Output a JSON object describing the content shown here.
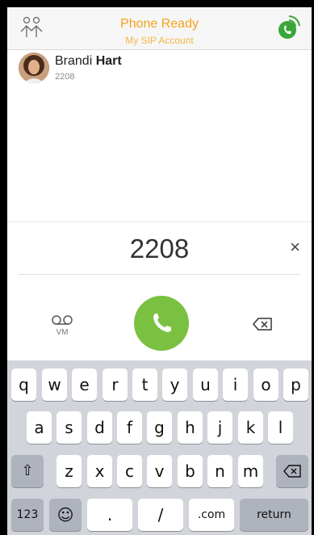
{
  "header": {
    "status_title": "Phone Ready",
    "status_subtitle": "My SIP Account",
    "left_icon": "contacts-icon",
    "right_icon": "call-status-icon",
    "accent_color": "#f5a31a",
    "status_icon_color": "#3aa63a"
  },
  "contact": {
    "first_name": "Brandi",
    "last_name": "Hart",
    "number": "2208"
  },
  "dialer": {
    "entered_number": "2208",
    "clear_label": "×",
    "voicemail_label": "VM",
    "call_color": "#7ac142"
  },
  "keyboard": {
    "row1": [
      "q",
      "w",
      "e",
      "r",
      "t",
      "y",
      "u",
      "i",
      "o",
      "p"
    ],
    "row2": [
      "a",
      "s",
      "d",
      "f",
      "g",
      "h",
      "j",
      "k",
      "l"
    ],
    "row3": [
      "z",
      "x",
      "c",
      "v",
      "b",
      "n",
      "m"
    ],
    "numbers_label": "123",
    "emoji_label": "☺",
    "dot_label": ".",
    "slash_label": "/",
    "dotcom_label": ".com",
    "return_label": "return"
  }
}
